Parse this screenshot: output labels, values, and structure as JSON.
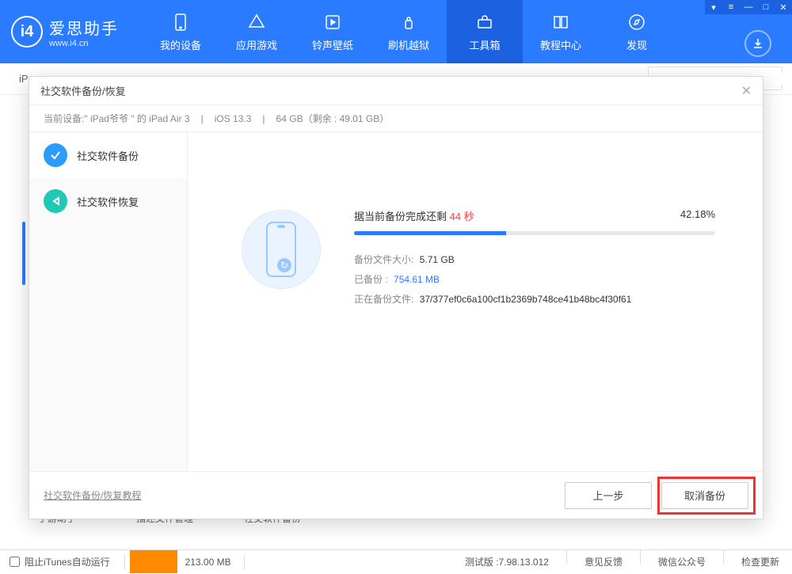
{
  "app": {
    "title": "爱思助手",
    "subtitle": "www.i4.cn"
  },
  "nav": {
    "items": [
      "我的设备",
      "应用游戏",
      "铃声壁纸",
      "刷机越狱",
      "工具箱",
      "教程中心",
      "发现"
    ],
    "active_index": 4
  },
  "subbar": {
    "tab": "iPa"
  },
  "bg_icons": {
    "a": "手游助手",
    "b": "描述文件管理",
    "c": "社交软件备份"
  },
  "dialog": {
    "title": "社交软件备份/恢复",
    "device_prefix": "当前设备:",
    "device_name": "\" iPad爷爷 \" 的 iPad Air 3",
    "ios": "iOS 13.3",
    "storage": "64 GB（剩余 : 49.01 GB）",
    "side": {
      "backup": "社交软件备份",
      "restore": "社交软件恢复"
    },
    "progress": {
      "prefix": "据当前备份完成还剩",
      "remaining": "44 秒",
      "percent": "42.18%",
      "percent_value": 42.18,
      "size_label": "备份文件大小:",
      "size_value": "5.71 GB",
      "done_label": "已备份 :",
      "done_value": "754.61 MB",
      "file_label": "正在备份文件:",
      "file_value": "37/377ef0c6a100cf1b2369b748ce41b48bc4f30f61"
    },
    "footer": {
      "tutorial": "社交软件备份/恢复教程",
      "prev": "上一步",
      "cancel": "取消备份"
    }
  },
  "statusbar": {
    "block_itunes": "阻止iTunes自动运行",
    "used_size": "213.00 MB",
    "version_label": "测试版 : ",
    "version": "7.98.13.012",
    "feedback": "意见反馈",
    "wechat": "微信公众号",
    "update": "检查更新"
  }
}
